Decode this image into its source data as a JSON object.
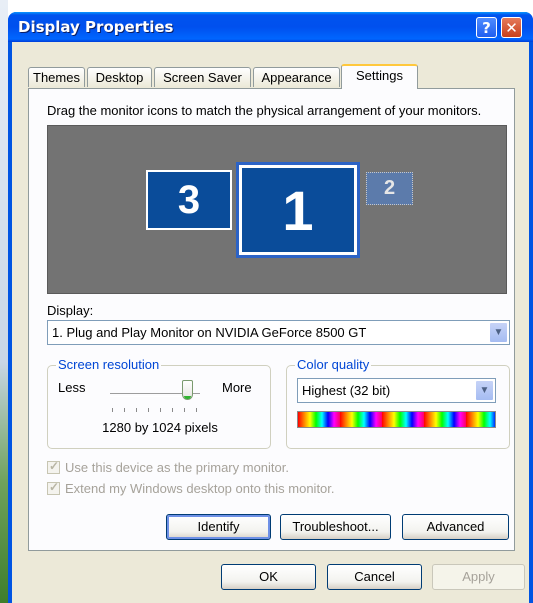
{
  "window": {
    "title": "Display Properties",
    "help_label": "?",
    "close_label": "✕"
  },
  "tabs": [
    {
      "label": "Themes"
    },
    {
      "label": "Desktop"
    },
    {
      "label": "Screen Saver"
    },
    {
      "label": "Appearance"
    },
    {
      "label": "Settings",
      "active": true
    }
  ],
  "settings": {
    "instruction": "Drag the monitor icons to match the physical arrangement of your monitors.",
    "monitors": [
      {
        "number": "3"
      },
      {
        "number": "1",
        "selected": true
      },
      {
        "number": "2",
        "inactive": true
      }
    ],
    "display_label": "Display:",
    "display_value": "1. Plug and Play Monitor on NVIDIA GeForce 8500 GT",
    "resolution": {
      "legend": "Screen resolution",
      "less_label": "Less",
      "more_label": "More",
      "value_text": "1280 by 1024 pixels",
      "slider_position_fraction": 0.86
    },
    "color_quality": {
      "legend": "Color quality",
      "selected": "Highest (32 bit)"
    },
    "primary_checkbox": {
      "label": "Use this device as the primary monitor.",
      "checked": true,
      "disabled": true
    },
    "extend_checkbox": {
      "label": "Extend my Windows desktop onto this monitor.",
      "checked": true,
      "disabled": true
    },
    "identify_label": "Identify",
    "troubleshoot_label": "Troubleshoot...",
    "advanced_label": "Advanced"
  },
  "footer": {
    "ok_label": "OK",
    "cancel_label": "Cancel",
    "apply_label": "Apply"
  },
  "colors": {
    "titlebar": "#0054e3",
    "monitor_blue": "#0a4c9a",
    "group_legend": "#0046d5",
    "dialog_bg": "#ece9d8"
  }
}
